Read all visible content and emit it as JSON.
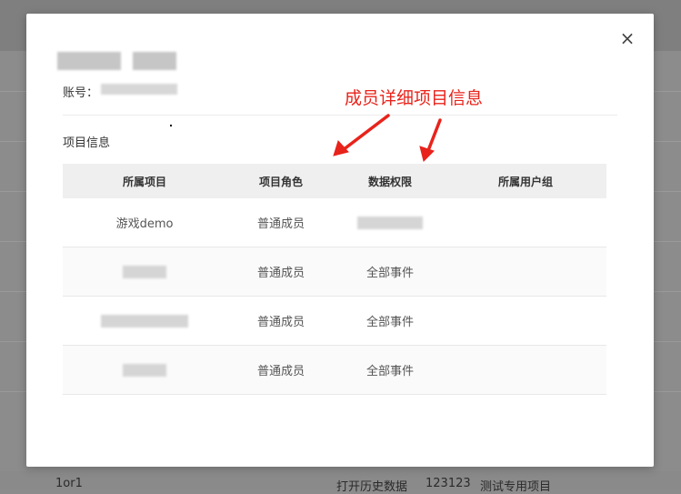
{
  "background": {
    "footer": [
      "1or1",
      "打开历史数据",
      "123123",
      "测试专用项目"
    ]
  },
  "modal": {
    "close_icon": "×",
    "account_label": "账号：",
    "section_title": "项目信息",
    "annotation": "成员详细项目信息",
    "table": {
      "headers": [
        "所属项目",
        "项目角色",
        "数据权限",
        "所属用户组"
      ],
      "rows": [
        {
          "project": "游戏demo",
          "role": "普通成员",
          "permission": "",
          "group": ""
        },
        {
          "project": "",
          "role": "普通成员",
          "permission": "全部事件",
          "group": ""
        },
        {
          "project": "",
          "role": "普通成员",
          "permission": "全部事件",
          "group": ""
        },
        {
          "project": "",
          "role": "普通成员",
          "permission": "全部事件",
          "group": ""
        }
      ]
    }
  },
  "colors": {
    "annotation": "#e8231b",
    "header_bg": "#efefef",
    "overlay": "#8c8c8c"
  }
}
